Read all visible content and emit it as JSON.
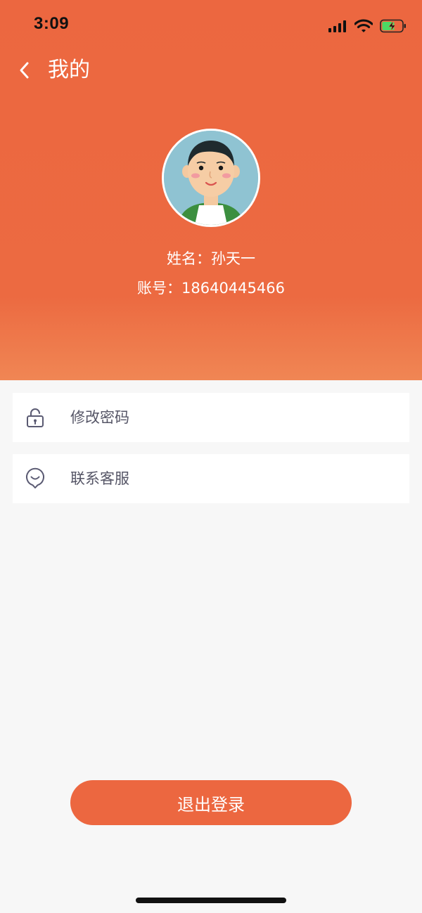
{
  "status_bar": {
    "time": "3:09",
    "icons": [
      "cellular-signal-icon",
      "wifi-icon",
      "battery-charging-icon"
    ]
  },
  "nav": {
    "title": "我的",
    "back_icon": "chevron-left-icon"
  },
  "profile": {
    "avatar_icon": "user-avatar",
    "name_line": "姓名：孙天一",
    "account_line": "账号：18640445466"
  },
  "menu": {
    "items": [
      {
        "label": "修改密码",
        "icon": "lock-icon"
      },
      {
        "label": "联系客服",
        "icon": "customer-service-icon"
      }
    ]
  },
  "logout": {
    "label": "退出登录"
  },
  "colors": {
    "accent": "#ec6740",
    "background": "#f7f7f7",
    "menu_text": "#555566",
    "icon_stroke": "#5a5a72"
  }
}
